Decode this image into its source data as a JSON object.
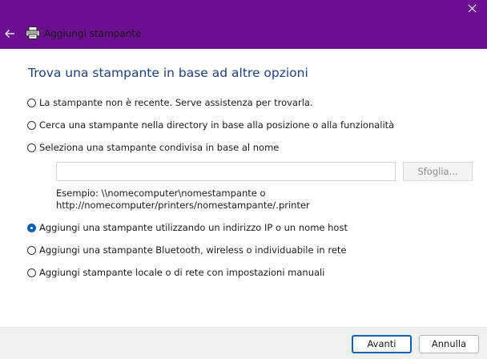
{
  "window": {
    "title": "Aggiungi stampante",
    "title_bar_color": "#6b0e8f"
  },
  "icons": {
    "close": "close-icon",
    "back": "back-arrow-icon",
    "printer": "printer-icon"
  },
  "content": {
    "heading": "Trova una stampante in base ad altre opzioni",
    "options": [
      {
        "label": "La stampante non è recente. Serve assistenza per trovarla.",
        "checked": false
      },
      {
        "label": "Cerca una stampante nella directory in base alla posizione o alla funzionalità",
        "checked": false
      },
      {
        "label": "Seleziona una stampante condivisa in base al nome",
        "checked": false
      },
      {
        "label": "Aggiungi una stampante utilizzando un indirizzo IP o un nome host",
        "checked": true
      },
      {
        "label": "Aggiungi una stampante Bluetooth, wireless o individuabile in rete",
        "checked": false
      },
      {
        "label": "Aggiungi stampante locale o di rete con impostazioni manuali",
        "checked": false
      }
    ],
    "shared_name_input": {
      "value": "",
      "placeholder": ""
    },
    "browse_label": "Sfoglia...",
    "example_line1": "Esempio: \\\\nomecomputer\\nomestampante o",
    "example_line2": "http://nomecomputer/printers/nomestampante/.printer"
  },
  "footer": {
    "next_label": "Avanti",
    "cancel_label": "Annulla"
  },
  "colors": {
    "accent": "#0a5fb4",
    "heading": "#1f3f7a"
  }
}
